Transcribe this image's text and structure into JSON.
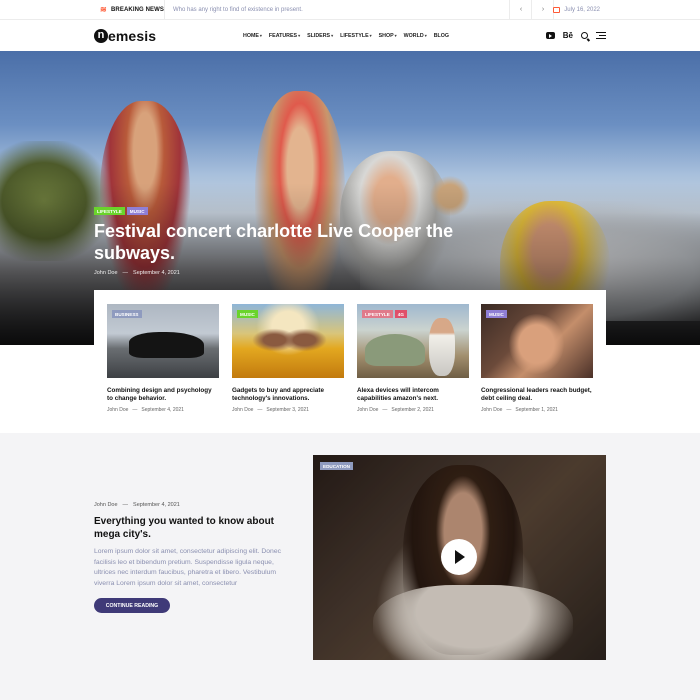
{
  "topbar": {
    "breaking_label": "BREAKING NEWS",
    "ticker": "Who has any right to find of existence in present.",
    "prev": "‹",
    "next": "›",
    "date": "July 16, 2022"
  },
  "nav": {
    "logo_mark": "n",
    "logo_rest": "emesis",
    "items": [
      {
        "label": "HOME",
        "dropdown": true
      },
      {
        "label": "FEATURES",
        "dropdown": true
      },
      {
        "label": "SLIDERS",
        "dropdown": true
      },
      {
        "label": "LIFESTYLE",
        "dropdown": true
      },
      {
        "label": "SHOP",
        "dropdown": true
      },
      {
        "label": "WORLD",
        "dropdown": true
      },
      {
        "label": "BLOG",
        "dropdown": false
      }
    ],
    "behance_label": "Bē"
  },
  "hero": {
    "tags": [
      {
        "label": "LIFESTYLE",
        "color": "#6ad42b"
      },
      {
        "label": "MUSIC",
        "color": "#8f7fd6"
      }
    ],
    "title": "Festival concert charlotte Live Cooper the subways.",
    "author": "John Doe",
    "dash": "—",
    "date": "September 4, 2021"
  },
  "cards": [
    {
      "tags": [
        {
          "label": "BUSINESS",
          "color": "#8f9bbf"
        }
      ],
      "title": "Combining design and psychology to change behavior.",
      "author": "John Doe",
      "date": "September 4, 2021"
    },
    {
      "tags": [
        {
          "label": "MUSIC",
          "color": "#6ad42b"
        }
      ],
      "title": "Gadgets to buy and appreciate technology's innovations.",
      "author": "John Doe",
      "date": "September 3, 2021"
    },
    {
      "tags": [
        {
          "label": "LIFESTYLE",
          "color": "#e07a8a"
        },
        {
          "label": "4G",
          "color": "#e0506a"
        }
      ],
      "title": "Alexa devices will intercom capabilities amazon's next.",
      "author": "John Doe",
      "date": "September 2, 2021"
    },
    {
      "tags": [
        {
          "label": "MUSIC",
          "color": "#8f7fd6"
        }
      ],
      "title": "Congressional leaders reach budget, debt ceiling deal.",
      "author": "John Doe",
      "date": "September 1, 2021"
    }
  ],
  "feature": {
    "author": "John Doe",
    "dash": "—",
    "date": "September 4, 2021",
    "title": "Everything you wanted to know about mega city's.",
    "excerpt": "Lorem ipsum dolor sit amet, consectetur adipiscing elit. Donec facilisis leo et bibendum pretium. Suspendisse ligula neque, ultrices nec interdum faucibus, pharetra et libero. Vestibulum viverra Lorem ipsum dolor sit amet, consectetur",
    "button": "CONTINUE READING",
    "video_tag": {
      "label": "EDUCATION",
      "color": "#8f9bbf"
    }
  },
  "colors": {
    "accent": "#3f3a78",
    "breaking": "#ff5a36"
  }
}
